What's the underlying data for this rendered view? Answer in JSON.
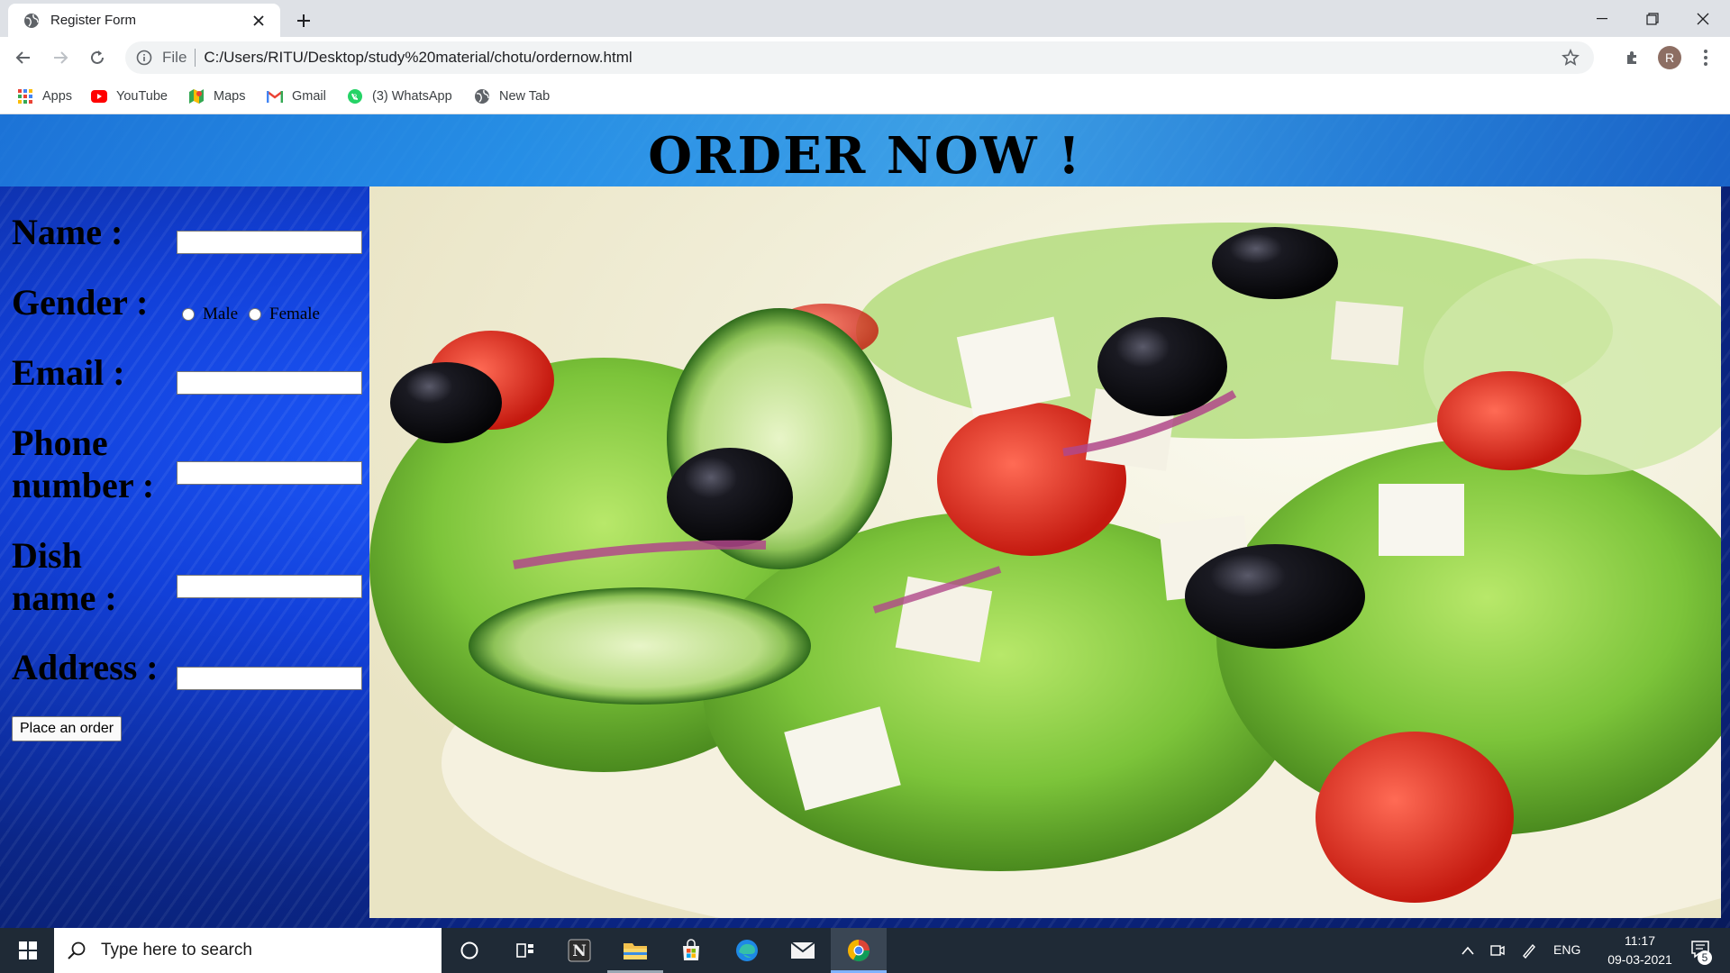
{
  "browser": {
    "tab_title": "Register Form",
    "omnibox_scheme": "File",
    "url": "C:/Users/RITU/Desktop/study%20material/chotu/ordernow.html",
    "profile_initial": "R",
    "bookmarks": [
      {
        "label": "Apps",
        "icon": "apps-grid-icon"
      },
      {
        "label": "YouTube",
        "icon": "youtube-icon"
      },
      {
        "label": "Maps",
        "icon": "maps-icon"
      },
      {
        "label": "Gmail",
        "icon": "gmail-icon"
      },
      {
        "label": "(3) WhatsApp",
        "icon": "whatsapp-icon"
      },
      {
        "label": "New Tab",
        "icon": "globe-icon"
      }
    ]
  },
  "page": {
    "title": "ORDER NOW !",
    "form": {
      "name_label": "Name :",
      "gender_label": "Gender :",
      "gender_options": [
        "Male",
        "Female"
      ],
      "email_label": "Email :",
      "phone_label_line1": "Phone",
      "phone_label_line2": "number :",
      "dish_label_line1": "Dish",
      "dish_label_line2": "name :",
      "address_label": "Address :",
      "name_value": "",
      "email_value": "",
      "phone_value": "",
      "dish_value": "",
      "address_value": "",
      "submit_label": "Place an order"
    },
    "image_subject": "salad-photo"
  },
  "taskbar": {
    "search_placeholder": "Type here to search",
    "language": "ENG",
    "time": "11:17",
    "date": "09-03-2021",
    "notification_count": "5"
  },
  "colors": {
    "page_background": "#1240d9",
    "title_glow": "#46b3f0",
    "taskbar": "#1f2a36",
    "chrome_tabstrip": "#dee1e6"
  }
}
